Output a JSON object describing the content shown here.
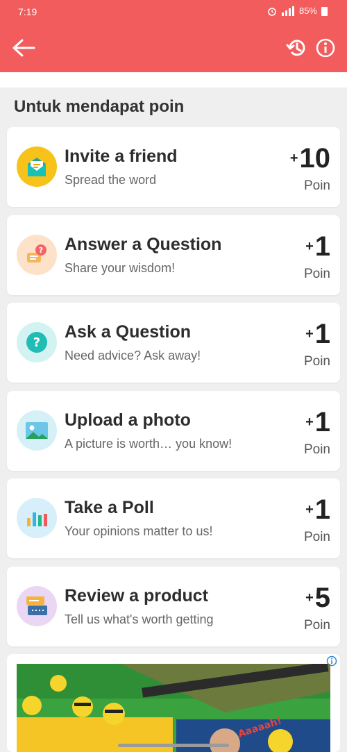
{
  "status": {
    "time": "7:19",
    "battery": "85%"
  },
  "header": {
    "back": "back",
    "history": "history",
    "info": "info"
  },
  "section": {
    "title": "Untuk mendapat poin"
  },
  "tasks": [
    {
      "title": "Invite a friend",
      "subtitle": "Spread the word",
      "plus": "+",
      "points": "10",
      "unit": "Poin",
      "icon": "mail-icon",
      "icon_bg": "#f7c21a"
    },
    {
      "title": "Answer a Question",
      "subtitle": "Share your wisdom!",
      "plus": "+",
      "points": "1",
      "unit": "Poin",
      "icon": "answer-icon",
      "icon_bg": "#fde1c8"
    },
    {
      "title": "Ask a Question",
      "subtitle": "Need advice? Ask away!",
      "plus": "+",
      "points": "1",
      "unit": "Poin",
      "icon": "question-icon",
      "icon_bg": "#d3f3f3"
    },
    {
      "title": "Upload a photo",
      "subtitle": "A picture is worth… you know!",
      "plus": "+",
      "points": "1",
      "unit": "Poin",
      "icon": "photo-icon",
      "icon_bg": "#d5f0f6"
    },
    {
      "title": "Take a Poll",
      "subtitle": "Your opinions matter to us!",
      "plus": "+",
      "points": "1",
      "unit": "Poin",
      "icon": "poll-icon",
      "icon_bg": "#d7eefb"
    },
    {
      "title": "Review a product",
      "subtitle": "Tell us what's worth getting",
      "plus": "+",
      "points": "5",
      "unit": "Poin",
      "icon": "review-icon",
      "icon_bg": "#ead7f3"
    }
  ],
  "ad": {
    "image_text": "Aaaaah!"
  }
}
